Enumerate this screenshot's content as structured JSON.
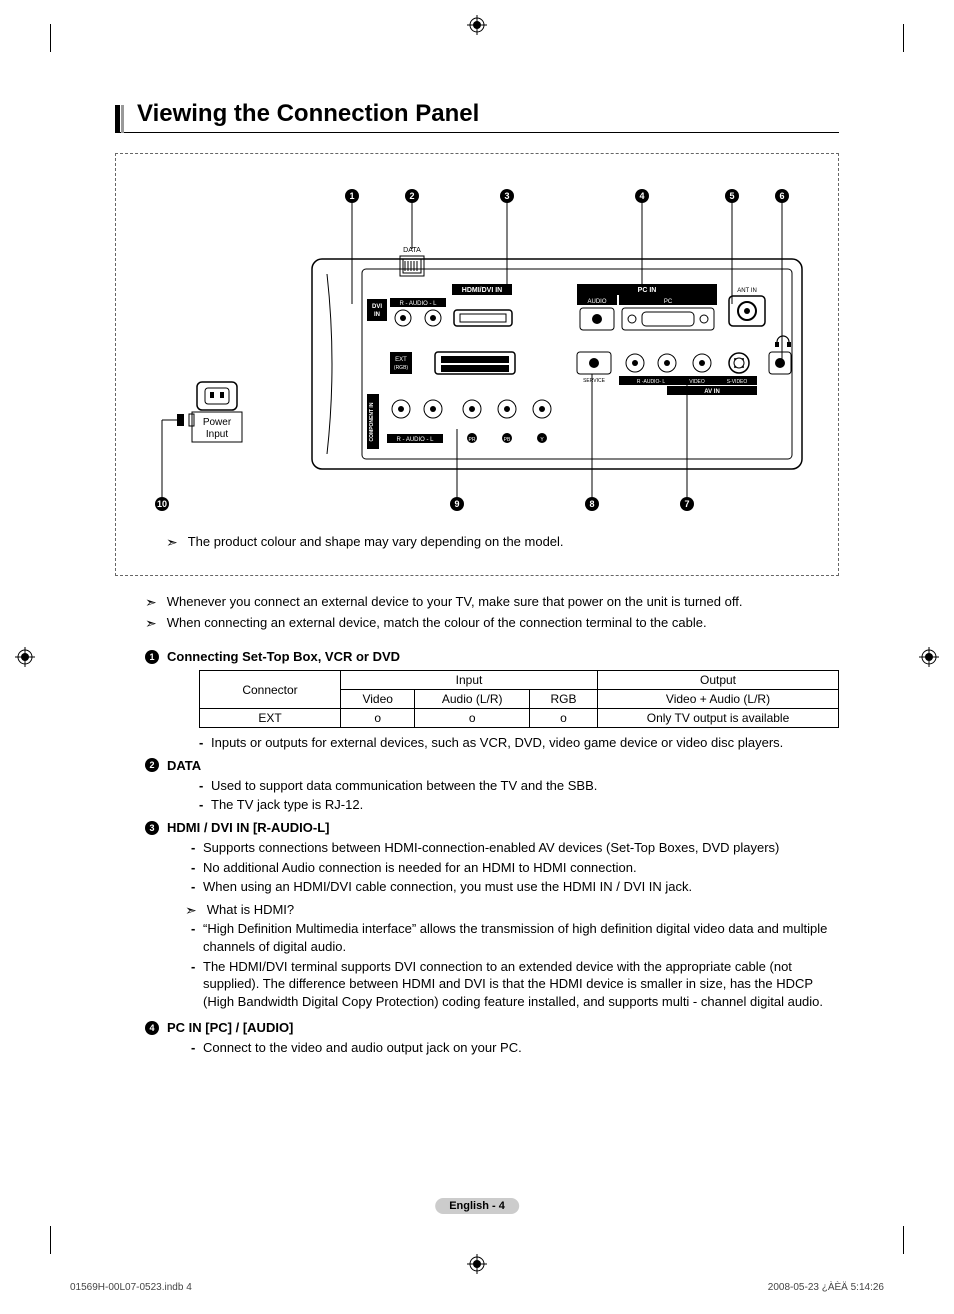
{
  "title": "Viewing the Connection Panel",
  "diagram": {
    "callouts": [
      "1",
      "2",
      "3",
      "4",
      "5",
      "6",
      "7",
      "8",
      "9",
      "10"
    ],
    "power_label_line1": "Power",
    "power_label_line2": "Input",
    "labels": {
      "data": "DATA",
      "hdmi_dvi_in": "HDMI/DVI IN",
      "dvi_in_1": "DVI",
      "dvi_in_2": "IN",
      "r_audio_l_1": "R - AUDIO - L",
      "ext_rgb_1": "EXT",
      "ext_rgb_2": "(RGB)",
      "component_in": "COMPONENT IN",
      "r_audio_l_2": "R - AUDIO - L",
      "pr": "PR",
      "pb": "PB",
      "y": "Y",
      "pc_in": "PC IN",
      "audio": "AUDIO",
      "pc": "PC",
      "ant_in": "ANT IN",
      "service": "SERVICE",
      "r_audio_l_3": "R -AUDIO- L",
      "video": "VIDEO",
      "s_video": "S-VIDEO",
      "av_in": "AV IN"
    }
  },
  "dashed_note": "The product colour and shape may vary depending on the model.",
  "top_notes": [
    "Whenever you connect an external device to your TV, make sure that power on the unit is turned off.",
    "When connecting an external device, match the colour of the connection terminal to the cable."
  ],
  "section1": {
    "num": "1",
    "heading": "Connecting Set-Top Box, VCR or DVD",
    "table": {
      "h_connector": "Connector",
      "h_input": "Input",
      "h_output": "Output",
      "h_video": "Video",
      "h_audio": "Audio (L/R)",
      "h_rgb": "RGB",
      "h_va": "Video + Audio (L/R)",
      "r_ext": "EXT",
      "r_o1": "o",
      "r_o2": "o",
      "r_o3": "o",
      "r_out": "Only TV output is available"
    },
    "bullets": [
      "Inputs or outputs for external devices, such as VCR, DVD, video game device or video disc players."
    ]
  },
  "section2": {
    "num": "2",
    "heading": "DATA",
    "bullets": [
      "Used to support data communication between the TV and the SBB.",
      "The TV jack type is RJ-12."
    ]
  },
  "section3": {
    "num": "3",
    "heading": "HDMI / DVI IN [R-AUDIO-L]",
    "bullets_a": [
      "Supports connections between HDMI-connection-enabled AV devices (Set-Top Boxes, DVD players)",
      "No additional Audio connection is needed for an HDMI to HDMI connection.",
      "When using an HDMI/DVI cable connection, you must use the HDMI IN / DVI IN jack."
    ],
    "arrow_q": "What is HDMI?",
    "bullets_b": [
      "“High Definition Multimedia interface” allows the transmission of high definition digital video data and multiple channels of digital audio.",
      "The HDMI/DVI terminal supports DVI connection to an extended device with the appropriate cable (not supplied). The difference between HDMI and DVI is that the HDMI device is smaller in size, has the HDCP (High Bandwidth Digital Copy Protection) coding feature installed, and supports multi - channel digital audio."
    ]
  },
  "section4": {
    "num": "4",
    "heading": "PC IN [PC] / [AUDIO]",
    "bullets": [
      "Connect to the video and audio output jack on your PC."
    ]
  },
  "footer": {
    "pill": "English - 4",
    "left": "01569H-00L07-0523.indb   4",
    "right": "2008-05-23   ¿ÀÈÄ 5:14:26"
  }
}
